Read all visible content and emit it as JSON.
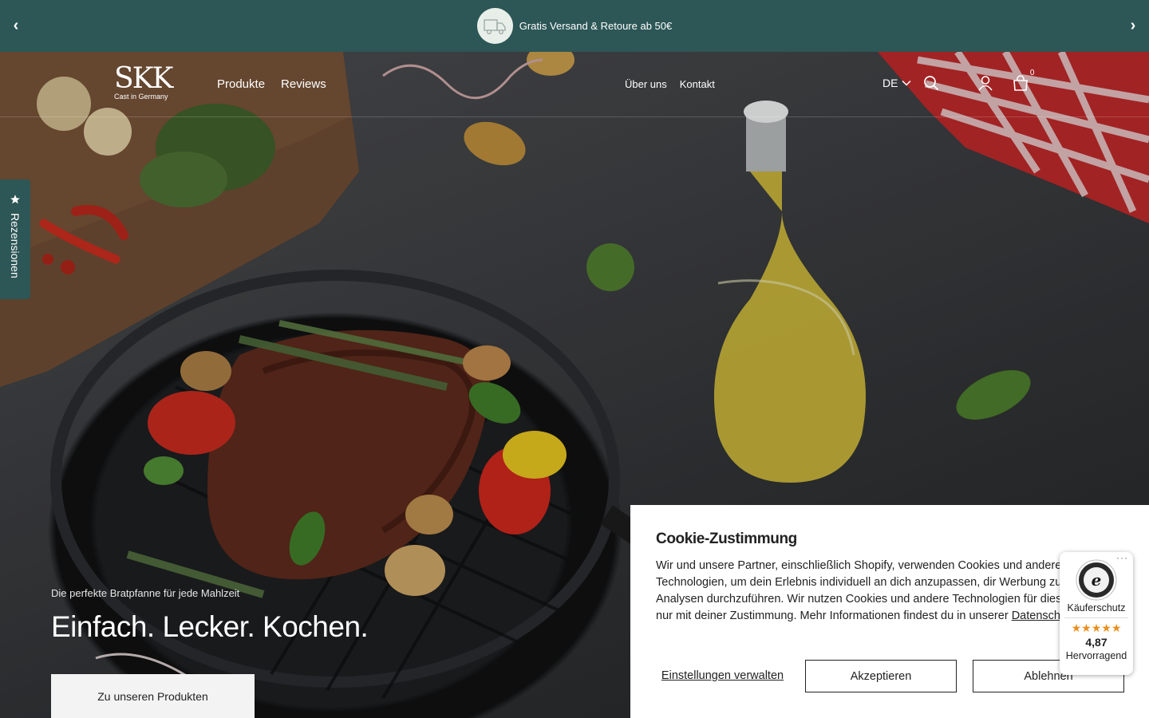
{
  "announcement": {
    "text": "Gratis Versand & Retoure ab 50€",
    "prev_label": "‹",
    "next_label": "›"
  },
  "header": {
    "logo_mark": "SKK",
    "logo_tagline": "Cast in Germany",
    "nav_main": [
      "Produkte",
      "Reviews"
    ],
    "nav_secondary": [
      "Über uns",
      "Kontakt"
    ],
    "language": "DE",
    "cart_count": "0"
  },
  "reviews_tab": {
    "label": "Rezensionen"
  },
  "hero": {
    "subtitle": "Die perfekte Bratpfanne für jede Mahlzeit",
    "title": "Einfach. Lecker. Kochen.",
    "cta": "Zu unseren Produkten"
  },
  "cookie": {
    "title": "Cookie-Zustimmung",
    "body": "Wir und unsere Partner, einschließlich Shopify, verwenden Cookies und andere Technologien, um dein Erlebnis individuell an dich anzupassen, dir Werbung zu zeigen und Analysen durchzuführen. Wir nutzen Cookies und andere Technologien für diese Zwecke nur mit deiner Zustimmung. Mehr Informationen findest du in unserer",
    "privacy_link": "Datenschutzerklärung",
    "manage_label": "Einstellungen verwalten",
    "accept_label": "Akzeptieren",
    "decline_label": "Ablehnen"
  },
  "trusted_shops": {
    "label": "Käuferschutz",
    "rating": "4,87",
    "grade": "Hervorragend",
    "stars": "★★★★★",
    "menu": "···"
  },
  "colors": {
    "brand_teal": "#2d5656",
    "star_orange": "#e98f1e"
  }
}
